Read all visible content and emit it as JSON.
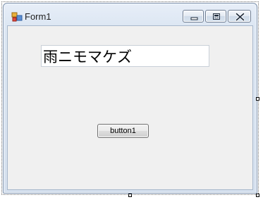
{
  "window": {
    "title": "Form1",
    "icon": "form-icon",
    "controls": {
      "minimize_icon": "minimize-icon",
      "maximize_icon": "maximize-icon",
      "close_icon": "close-icon"
    }
  },
  "form": {
    "textbox_value": "雨ニモマケズ",
    "button_label": "button1"
  },
  "colors": {
    "client_background": "#f0f0f0",
    "titlebar_top": "#e7eef8",
    "titlebar_bottom": "#d5e0ee",
    "window_border": "#7a8fab"
  }
}
